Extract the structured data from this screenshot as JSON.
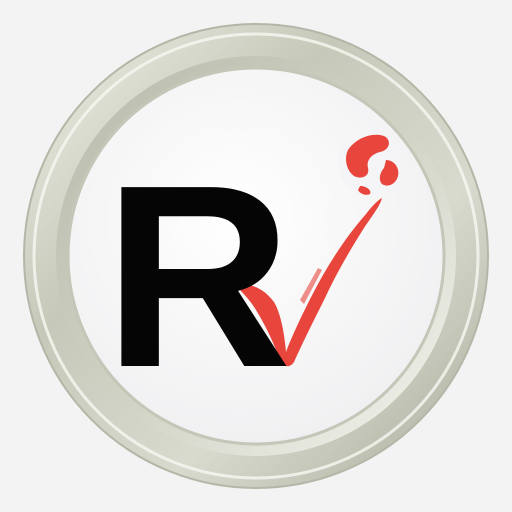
{
  "logo": {
    "letter": "R",
    "letter_color": "#050505",
    "checkmark_color": "#e8463c",
    "globe_color": "#e8463c",
    "ring_color": "#c9cbbd",
    "face_color": "#f5f5f7",
    "background_color": "#f3f3f4"
  }
}
